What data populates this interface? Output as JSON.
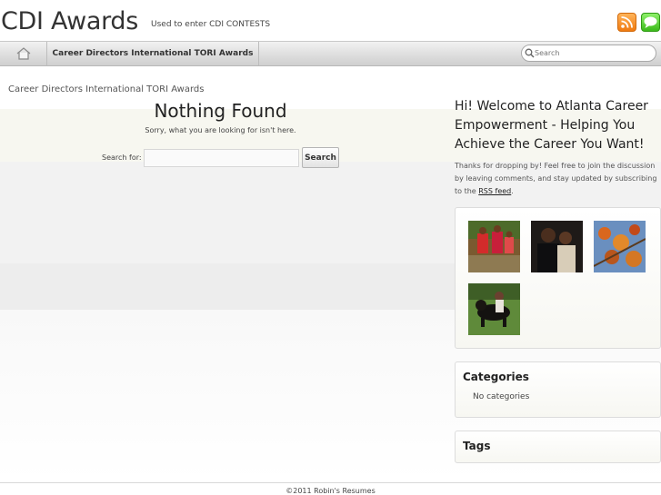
{
  "header": {
    "site_title": "CDI Awards",
    "site_description": "Used to enter CDI CONTESTS",
    "icons": [
      "rss-icon",
      "chat-icon"
    ]
  },
  "nav": {
    "home_icon": "home-icon",
    "item": "Career Directors International TORI Awards",
    "search_placeholder": "Search"
  },
  "main": {
    "breadcrumb": "Career Directors International TORI Awards",
    "title": "Nothing Found",
    "message": "Sorry, what you are looking for isn't here.",
    "search_label": "Search for:",
    "search_value": "",
    "search_button": "Search"
  },
  "sidebar": {
    "welcome_title": "Hi! Welcome to Atlanta Career Empowerment - Helping You Achieve the Career You Want!",
    "welcome_text": "Thanks for dropping by! Feel free to join the discussion by leaving comments, and stay updated by subscribing to the",
    "rss_link": "RSS feed",
    "welcome_text_end": ".",
    "photos": [
      "photo-women-in-red",
      "photo-couple-portrait",
      "photo-autumn-leaves",
      "photo-dog-on-grass"
    ],
    "categories_title": "Categories",
    "categories_empty": "No categories",
    "tags_title": "Tags"
  },
  "footer": {
    "copyright": "©2011 Robin's Resumes"
  },
  "colors": {
    "rss": "#f07a10",
    "chat": "#3cba1c",
    "nav_bg": "#dedede"
  }
}
